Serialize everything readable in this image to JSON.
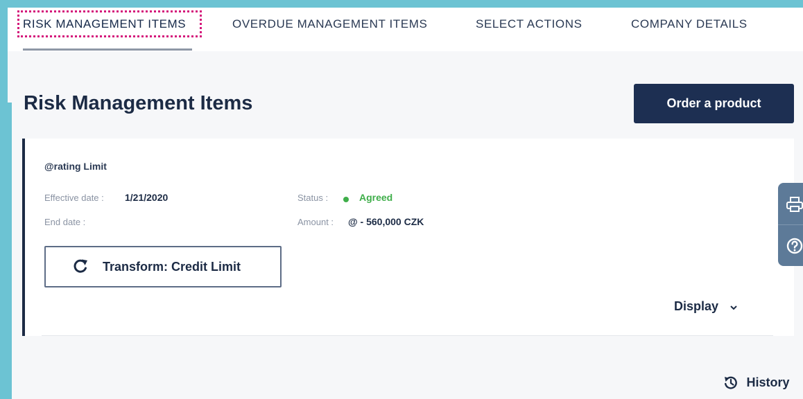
{
  "tabs": {
    "risk": "RISK MANAGEMENT ITEMS",
    "overdue": "OVERDUE MANAGEMENT ITEMS",
    "select": "SELECT ACTIONS",
    "company": "COMPANY DETAILS"
  },
  "page": {
    "title": "Risk Management Items",
    "order_button": "Order a product"
  },
  "card": {
    "title": "@rating Limit",
    "effective_date_label": "Effective date :",
    "effective_date_value": "1/21/2020",
    "end_date_label": "End date :",
    "status_label": "Status :",
    "status_value": "Agreed",
    "amount_label": "Amount :",
    "amount_value": "@ - 560,000 CZK",
    "transform_button": "Transform: Credit Limit",
    "display_toggle": "Display"
  },
  "footer": {
    "history": "History"
  },
  "icons": {
    "transform": "refresh-icon",
    "display": "chevron-down-icon",
    "side_top": "printer-icon",
    "side_bottom": "help-icon",
    "history": "history-icon"
  },
  "colors": {
    "frame": "#6cc3d3",
    "primary": "#1d2f52",
    "status_agreed": "#3fae4a",
    "focus_outline": "#d4157a"
  }
}
